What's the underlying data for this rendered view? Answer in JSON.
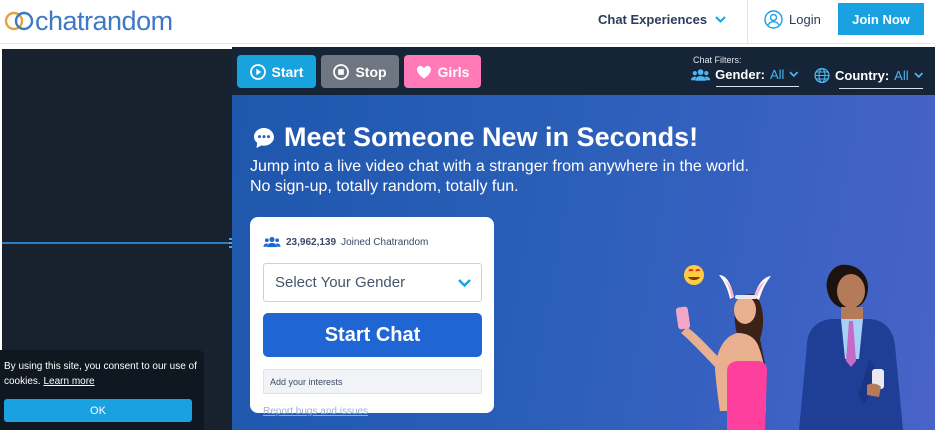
{
  "header": {
    "logo_text": "chatrandom",
    "nav_experiences": "Chat Experiences",
    "login_label": "Login",
    "join_label": "Join Now"
  },
  "toolbar": {
    "start_label": "Start",
    "stop_label": "Stop",
    "girls_label": "Girls",
    "filters_label": "Chat Filters:",
    "gender_label": "Gender:",
    "gender_value": "All",
    "country_label": "Country:",
    "country_value": "All"
  },
  "hero": {
    "title": "Meet Someone New in Seconds!",
    "subtitle_line1": "Jump into a live video chat with a stranger from anywhere in the world.",
    "subtitle_line2": "No sign-up, totally random, totally fun."
  },
  "card": {
    "joined_count": "23,962,139",
    "joined_text": "Joined Chatrandom",
    "gender_placeholder": "Select Your Gender",
    "start_chat_label": "Start Chat",
    "interests_placeholder": "Add your interests",
    "report_link": "Report bugs and issues"
  },
  "cookie": {
    "text": "By using this site, you consent to our use of cookies.",
    "learn_more": "Learn more",
    "ok_label": "OK"
  },
  "colors": {
    "brand": "#3d79c4",
    "accent": "#1aa1e2",
    "start_chat": "#1f66d4",
    "girls": "#ff7ab6",
    "stop": "#6e7682",
    "hero_bg": "#2a5fb8"
  }
}
